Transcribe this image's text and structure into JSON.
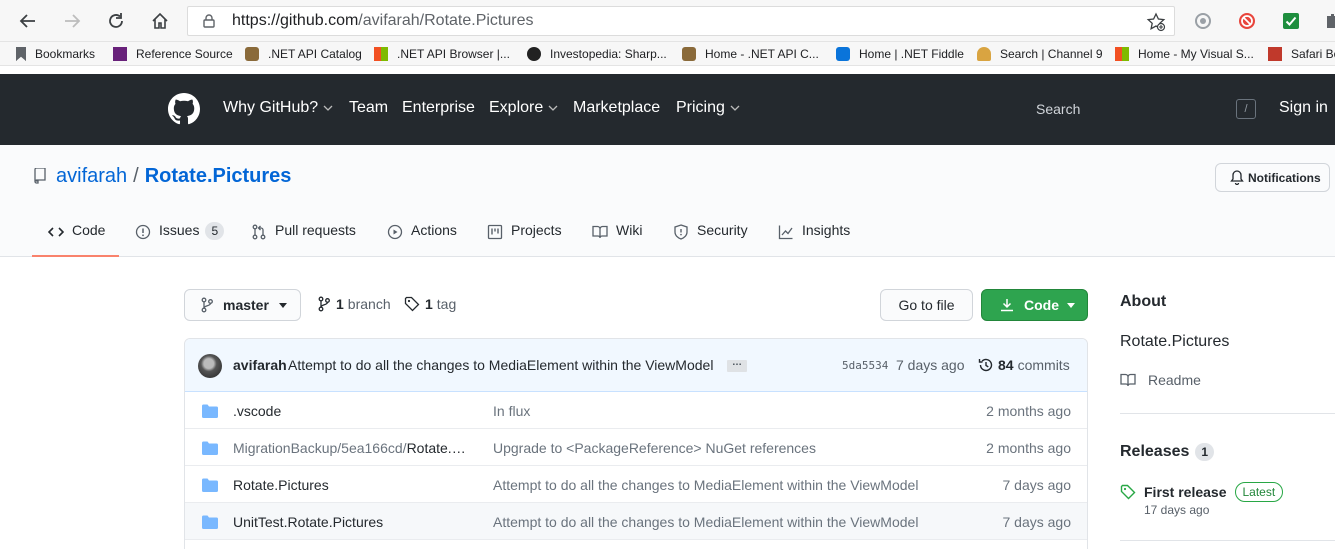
{
  "browser": {
    "url_host": "https://github.com",
    "url_path": "/avifarah/Rotate.Pictures",
    "bookmarks": [
      {
        "label": "Bookmarks",
        "icon": "bookmark-icon",
        "color": "#5f6368"
      },
      {
        "label": "Reference Source",
        "icon": "dotnet-icon",
        "color": "#68217a"
      },
      {
        "label": ".NET API Catalog",
        "icon": "db-icon",
        "color": "#8a6a3a"
      },
      {
        "label": ".NET API Browser |...",
        "icon": "ms-icon",
        "color": "#f25022"
      },
      {
        "label": "Investopedia: Sharp...",
        "icon": "investopedia-icon",
        "color": "#222222"
      },
      {
        "label": "Home - .NET API C...",
        "icon": "db-icon",
        "color": "#8a6a3a"
      },
      {
        "label": "Home | .NET Fiddle",
        "icon": "fiddle-icon",
        "color": "#0a74da"
      },
      {
        "label": "Search | Channel 9",
        "icon": "ch9-icon",
        "color": "#d9a441"
      },
      {
        "label": "Home - My Visual S...",
        "icon": "ms-icon",
        "color": "#f25022"
      },
      {
        "label": "Safari Bo",
        "icon": "safari-icon",
        "color": "#c0392b"
      }
    ]
  },
  "header": {
    "nav": [
      "Why GitHub?",
      "Team",
      "Enterprise",
      "Explore",
      "Marketplace",
      "Pricing"
    ],
    "search_label": "Search",
    "slash": "/",
    "sign_in": "Sign in"
  },
  "repo": {
    "owner": "avifarah",
    "separator": "/",
    "name": "Rotate.Pictures",
    "notifications_label": "Notifications",
    "tabs": [
      {
        "label": "Code",
        "icon": "code-icon"
      },
      {
        "label": "Issues",
        "icon": "issue-icon",
        "count": "5"
      },
      {
        "label": "Pull requests",
        "icon": "pull-request-icon"
      },
      {
        "label": "Actions",
        "icon": "play-icon"
      },
      {
        "label": "Projects",
        "icon": "project-icon"
      },
      {
        "label": "Wiki",
        "icon": "book-icon"
      },
      {
        "label": "Security",
        "icon": "shield-icon"
      },
      {
        "label": "Insights",
        "icon": "graph-icon"
      }
    ]
  },
  "toolbar": {
    "branch": "master",
    "branch_count": "1",
    "branch_word": "branch",
    "tag_count": "1",
    "tag_word": "tag",
    "goto_file": "Go to file",
    "code": "Code"
  },
  "commit": {
    "author": "avifarah",
    "message": "Attempt to do all the changes to MediaElement within the ViewModel",
    "ellipsis": "…",
    "sha": "5da5534",
    "date": "7 days ago",
    "count": "84",
    "count_word": "commits"
  },
  "files": [
    {
      "name": ".vscode",
      "name_dim": "",
      "message": "In flux",
      "date": "2 months ago"
    },
    {
      "name": "Rotate.Pi...",
      "name_dim": "MigrationBackup/5ea166cd/",
      "message": "Upgrade to <PackageReference> NuGet references",
      "date": "2 months ago"
    },
    {
      "name": "Rotate.Pictures",
      "name_dim": "",
      "message": "Attempt to do all the changes to MediaElement within the ViewModel",
      "date": "7 days ago"
    },
    {
      "name": "UnitTest.Rotate.Pictures",
      "name_dim": "",
      "message": "Attempt to do all the changes to MediaElement within the ViewModel",
      "date": "7 days ago"
    }
  ],
  "sidebar": {
    "about_title": "About",
    "description": "Rotate.Pictures",
    "readme": "Readme",
    "releases_title": "Releases",
    "releases_count": "1",
    "release_name": "First release",
    "latest_label": "Latest",
    "release_date": "17 days ago"
  }
}
